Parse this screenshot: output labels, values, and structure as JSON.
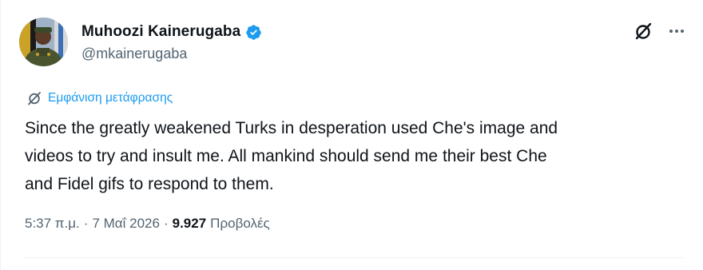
{
  "author": {
    "display_name": "Muhoozi Kainerugaba",
    "handle": "@mkainerugaba",
    "verified": true
  },
  "actions": {
    "grok_icon": "grok-icon",
    "more_icon": "more-icon"
  },
  "translate": {
    "label": "Εμφάνιση μετάφρασης",
    "icon": "grok-icon"
  },
  "tweet": {
    "text": "Since the greatly weakened Turks in desperation used Che's image and\nvideos to try and insult me. All mankind should send me their best Che\nand Fidel gifs to respond to them."
  },
  "meta": {
    "time": "5:37 π.μ.",
    "separator": "·",
    "date": "7 Μαΐ 2026",
    "separator2": "·",
    "views_count": "9.927",
    "views_label": "Προβολές"
  },
  "colors": {
    "accent": "#1d9bf0",
    "text": "#0f1419",
    "secondary": "#536471"
  }
}
